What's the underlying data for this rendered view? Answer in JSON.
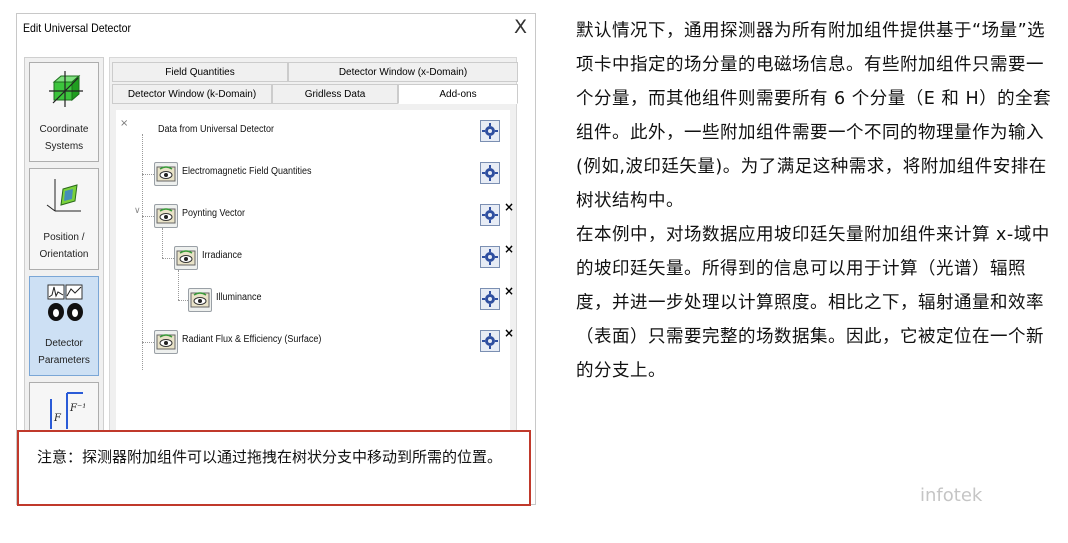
{
  "dialog": {
    "title": "Edit Universal Detector",
    "close_glyph": "X"
  },
  "nav": {
    "items": [
      {
        "label_line1": "Coordinate",
        "label_line2": "Systems",
        "icon": "coordinate-systems-icon"
      },
      {
        "label_line1": "Position /",
        "label_line2": "Orientation",
        "icon": "position-orientation-icon"
      },
      {
        "label_line1": "Detector",
        "label_line2": "Parameters",
        "icon": "detector-parameters-icon"
      },
      {
        "label_line1": "",
        "label_line2": "",
        "icon": "fourier-transform-icon"
      }
    ]
  },
  "tabs": {
    "row1": [
      "Field Quantities",
      "Detector Window (x-Domain)"
    ],
    "row2": [
      "Detector Window (k-Domain)",
      "Gridless Data",
      "Add-ons"
    ],
    "active": "Add-ons"
  },
  "tree": {
    "root": "Data from Universal Detector",
    "items": [
      {
        "label": "Electromagnetic Field Quantities",
        "removable": false
      },
      {
        "label": "Poynting Vector",
        "removable": true
      },
      {
        "label": "Irradiance",
        "removable": true
      },
      {
        "label": "Illuminance",
        "removable": true
      },
      {
        "label": "Radiant Flux & Efficiency (Surface)",
        "removable": true
      }
    ],
    "remove_glyph": "×",
    "expand_glyph": "∨"
  },
  "note": {
    "text": "注意：探测器附加组件可以通过拖拽在树状分支中移动到所需的位置。"
  },
  "article": {
    "para1": "默认情况下，通用探测器为所有附加组件提供基于“场量”选项卡中指定的场分量的电磁场信息。有些附加组件只需要一个分量，而其他组件则需要所有 6 个分量（E 和 H）的全套组件。此外，一些附加组件需要一个不同的物理量作为输入(例如,波印廷矢量)。为了满足这种需求，将附加组件安排在树状结构中。",
    "para2": "在本例中，对场数据应用坡印廷矢量附加组件来计算 x-域中的坡印廷矢量。所得到的信息可以用于计算（光谱）辐照度，并进一步处理以计算照度。相比之下，辐射通量和效率（表面）只需要完整的场数据集。因此，它被定位在一个新的分支上。"
  },
  "watermark": "infotek",
  "colors": {
    "note_border": "#c0392b",
    "active_nav": "#cde0f4",
    "gear": "#e7ecf5"
  }
}
